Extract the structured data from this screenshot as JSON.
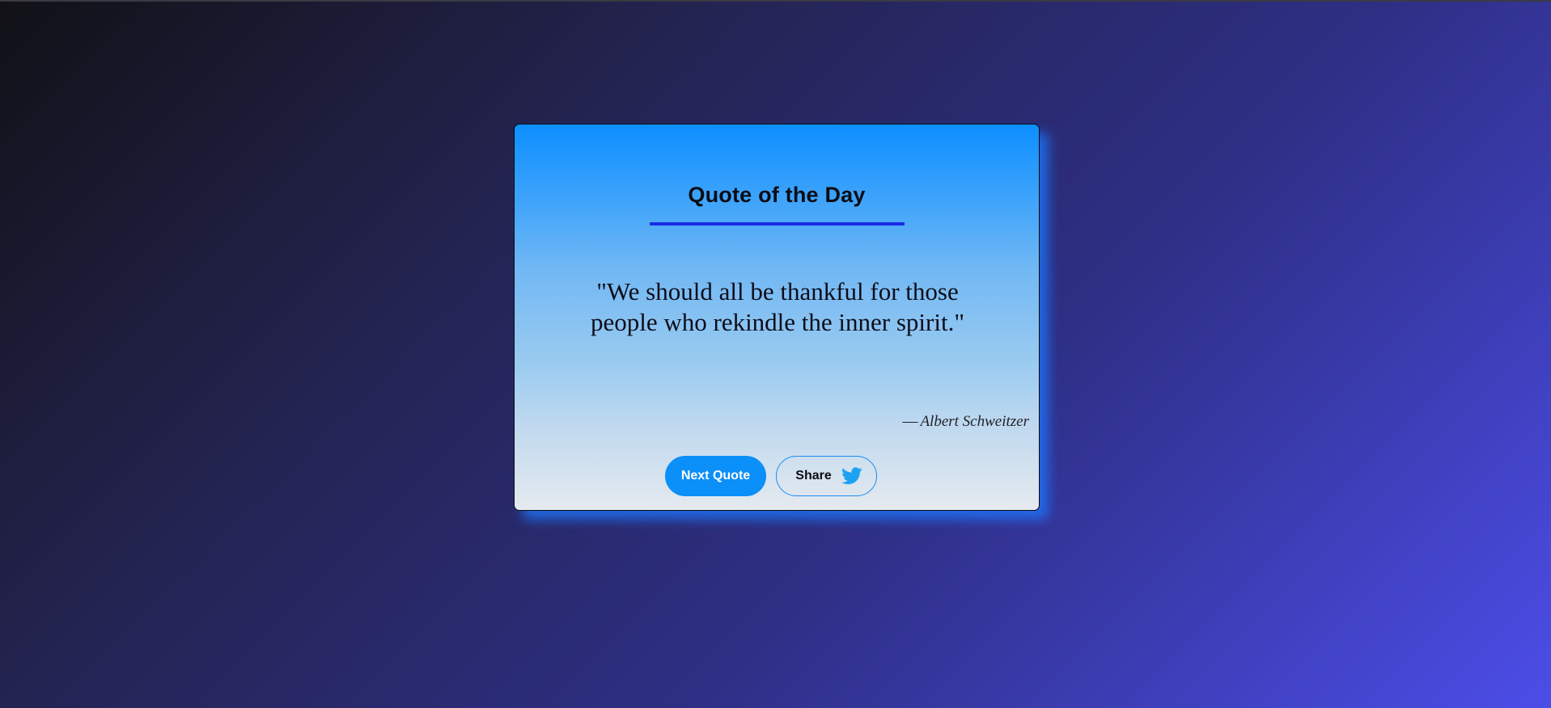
{
  "card": {
    "title": "Quote of the Day",
    "quote": "\"We should all be thankful for those people who rekindle the inner spirit.\"",
    "author_dash": "—",
    "author": "Albert Schweitzer"
  },
  "buttons": {
    "next_label": "Next Quote",
    "share_label": "Share",
    "share_icon": "twitter-icon"
  },
  "colors": {
    "primary": "#0b8ff8",
    "underline": "#1a2be6",
    "twitter": "#1da1f2"
  }
}
